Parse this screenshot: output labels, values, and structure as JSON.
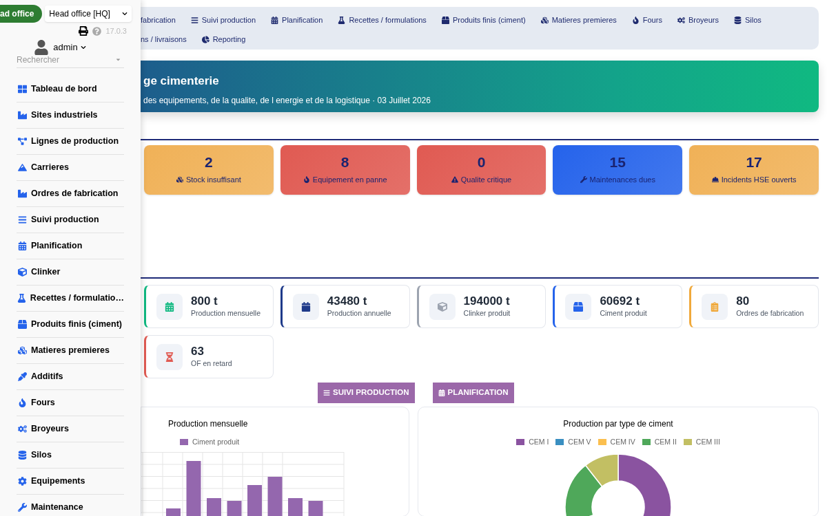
{
  "sidebar": {
    "company_badge": "ad office",
    "company_select": "Head office [HQ]",
    "version": "17.0.3",
    "user": "admin",
    "search": {
      "placeholder": "Rechercher"
    },
    "items": [
      {
        "label": "Tableau de bord"
      },
      {
        "label": "Sites industriels"
      },
      {
        "label": "Lignes de production"
      },
      {
        "label": "Carrieres"
      },
      {
        "label": "Ordres de fabrication"
      },
      {
        "label": "Suivi production"
      },
      {
        "label": "Planification"
      },
      {
        "label": "Clinker"
      },
      {
        "label": "Recettes / formulatio…"
      },
      {
        "label": "Produits finis (ciment)"
      },
      {
        "label": "Matieres premieres"
      },
      {
        "label": "Additifs"
      },
      {
        "label": "Fours"
      },
      {
        "label": "Broyeurs"
      },
      {
        "label": "Silos"
      },
      {
        "label": "Equipements"
      },
      {
        "label": "Maintenance"
      }
    ]
  },
  "nav": [
    [
      {
        "label": "fabrication"
      },
      {
        "label": "Suivi production"
      },
      {
        "label": "Planification"
      },
      {
        "label": "Recettes / formulations"
      },
      {
        "label": "Produits finis (ciment)"
      },
      {
        "label": "Matieres premieres"
      },
      {
        "label": "Fours"
      },
      {
        "label": "Broyeurs"
      },
      {
        "label": "Silos"
      }
    ],
    [
      {
        "label": "ns / livraisons"
      },
      {
        "label": "Reporting"
      }
    ]
  ],
  "hero": {
    "title": "ge cimenterie",
    "subtitle": "des equipements, de la qualite, de l energie et de la logistique · 03 Juillet 2026"
  },
  "alerts": [
    {
      "value": "2",
      "label": "Stock insuffisant",
      "color": "#f0b157"
    },
    {
      "value": "8",
      "label": "Equipement en panne",
      "color": "#e05a52"
    },
    {
      "value": "0",
      "label": "Qualite critique",
      "color": "#e05a52"
    },
    {
      "value": "15",
      "label": "Maintenances dues",
      "color": "#2563eb"
    },
    {
      "value": "17",
      "label": "Incidents HSE ouverts",
      "color": "#f0b157"
    }
  ],
  "kpis": [
    {
      "value": "800 t",
      "label": "Production mensuelle",
      "color": "#10b981"
    },
    {
      "value": "43480 t",
      "label": "Production annuelle",
      "color": "#1e3a8a"
    },
    {
      "value": "194000 t",
      "label": "Clinker produit",
      "color": "#9ca3af"
    },
    {
      "value": "60692 t",
      "label": "Ciment produit",
      "color": "#2563eb"
    },
    {
      "value": "80",
      "label": "Ordres de fabrication",
      "color": "#f0a93b"
    },
    {
      "value": "63",
      "label": "OF en retard",
      "color": "#e05a52"
    }
  ],
  "buttons": [
    "SUIVI PRODUCTION",
    "PLANIFICATION"
  ],
  "charts": [
    {
      "title": "Production mensuelle",
      "legend": [
        {
          "label": "Ciment produit",
          "color": "#9467ae"
        }
      ]
    },
    {
      "title": "Production par type de ciment",
      "legend": [
        {
          "label": "CEM I",
          "color": "#8a53a0"
        },
        {
          "label": "CEM V",
          "color": "#3a8fc1"
        },
        {
          "label": "CEM IV",
          "color": "#fbbf4f"
        },
        {
          "label": "CEM II",
          "color": "#4fa85a"
        },
        {
          "label": "CEM III",
          "color": "#c2bf63"
        }
      ]
    }
  ]
}
